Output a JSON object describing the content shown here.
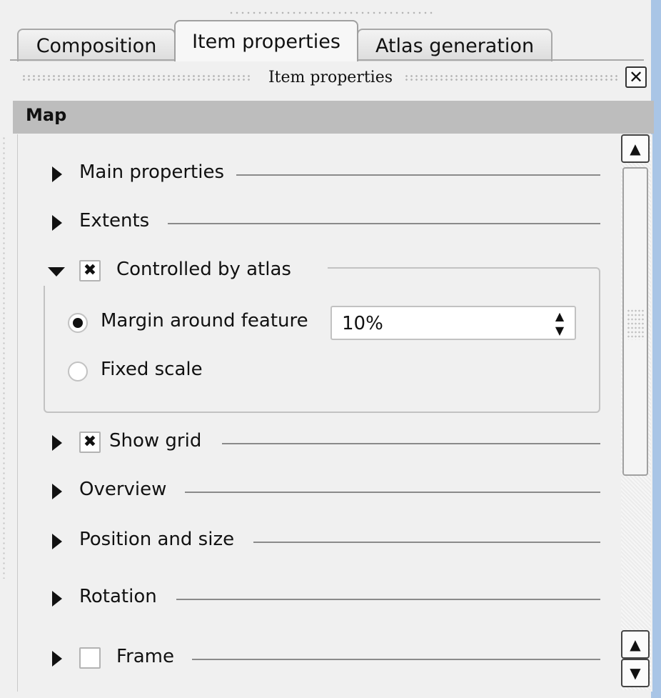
{
  "tabs": [
    {
      "label": "Composition",
      "active": false
    },
    {
      "label": "Item properties",
      "active": true
    },
    {
      "label": "Atlas generation",
      "active": false
    }
  ],
  "dock": {
    "title": "Item properties",
    "close_icon": "✕"
  },
  "section_header": "Map",
  "sections": {
    "main_properties": {
      "label": "Main properties",
      "expanded": false
    },
    "extents": {
      "label": "Extents",
      "expanded": false
    },
    "controlled_by_atlas": {
      "label": "Controlled by atlas",
      "expanded": true,
      "checked": true,
      "check_glyph": "✖",
      "options": {
        "margin": {
          "label": "Margin around feature",
          "selected": true,
          "value": "10%"
        },
        "fixed_scale": {
          "label": "Fixed scale",
          "selected": false
        }
      }
    },
    "show_grid": {
      "label": "Show grid",
      "expanded": false,
      "checked": true,
      "check_glyph": "✖"
    },
    "overview": {
      "label": "Overview",
      "expanded": false
    },
    "position_size": {
      "label": "Position and size",
      "expanded": false
    },
    "rotation": {
      "label": "Rotation",
      "expanded": false
    },
    "frame": {
      "label": "Frame",
      "expanded": false,
      "checked": false
    }
  },
  "scrollbar": {
    "up_glyph": "▲",
    "down_glyph": "▼"
  },
  "colors": {
    "header_bg": "#bdbdbd",
    "window_edge": "#a9c5e6",
    "panel_bg": "#f0f0f0"
  }
}
